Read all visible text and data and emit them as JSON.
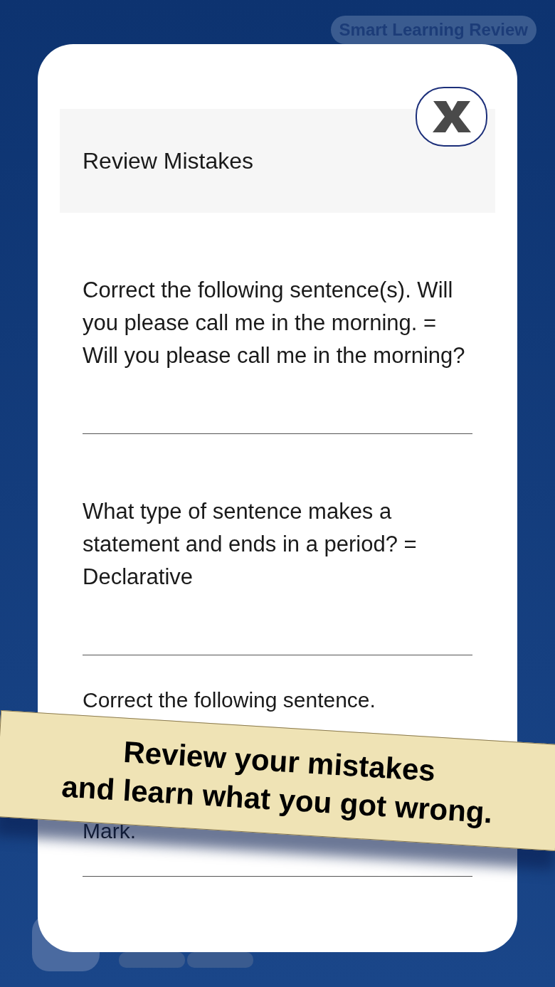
{
  "background_button": {
    "label": "Smart Learning Review"
  },
  "modal": {
    "title": "Review Mistakes",
    "items": [
      {
        "kind": "full",
        "text": "Correct the following sentence(s). Will you please call me in the morning. = Will you please call me in the morning?"
      },
      {
        "kind": "full",
        "text": "What type of sentence makes a statement and ends in a period? = Declarative"
      },
      {
        "kind": "covered",
        "text": "Correct the following sentence.",
        "text_end": "Mark."
      }
    ]
  },
  "banner": {
    "lines": [
      "Review your mistakes",
      "and learn what you got wrong."
    ]
  }
}
